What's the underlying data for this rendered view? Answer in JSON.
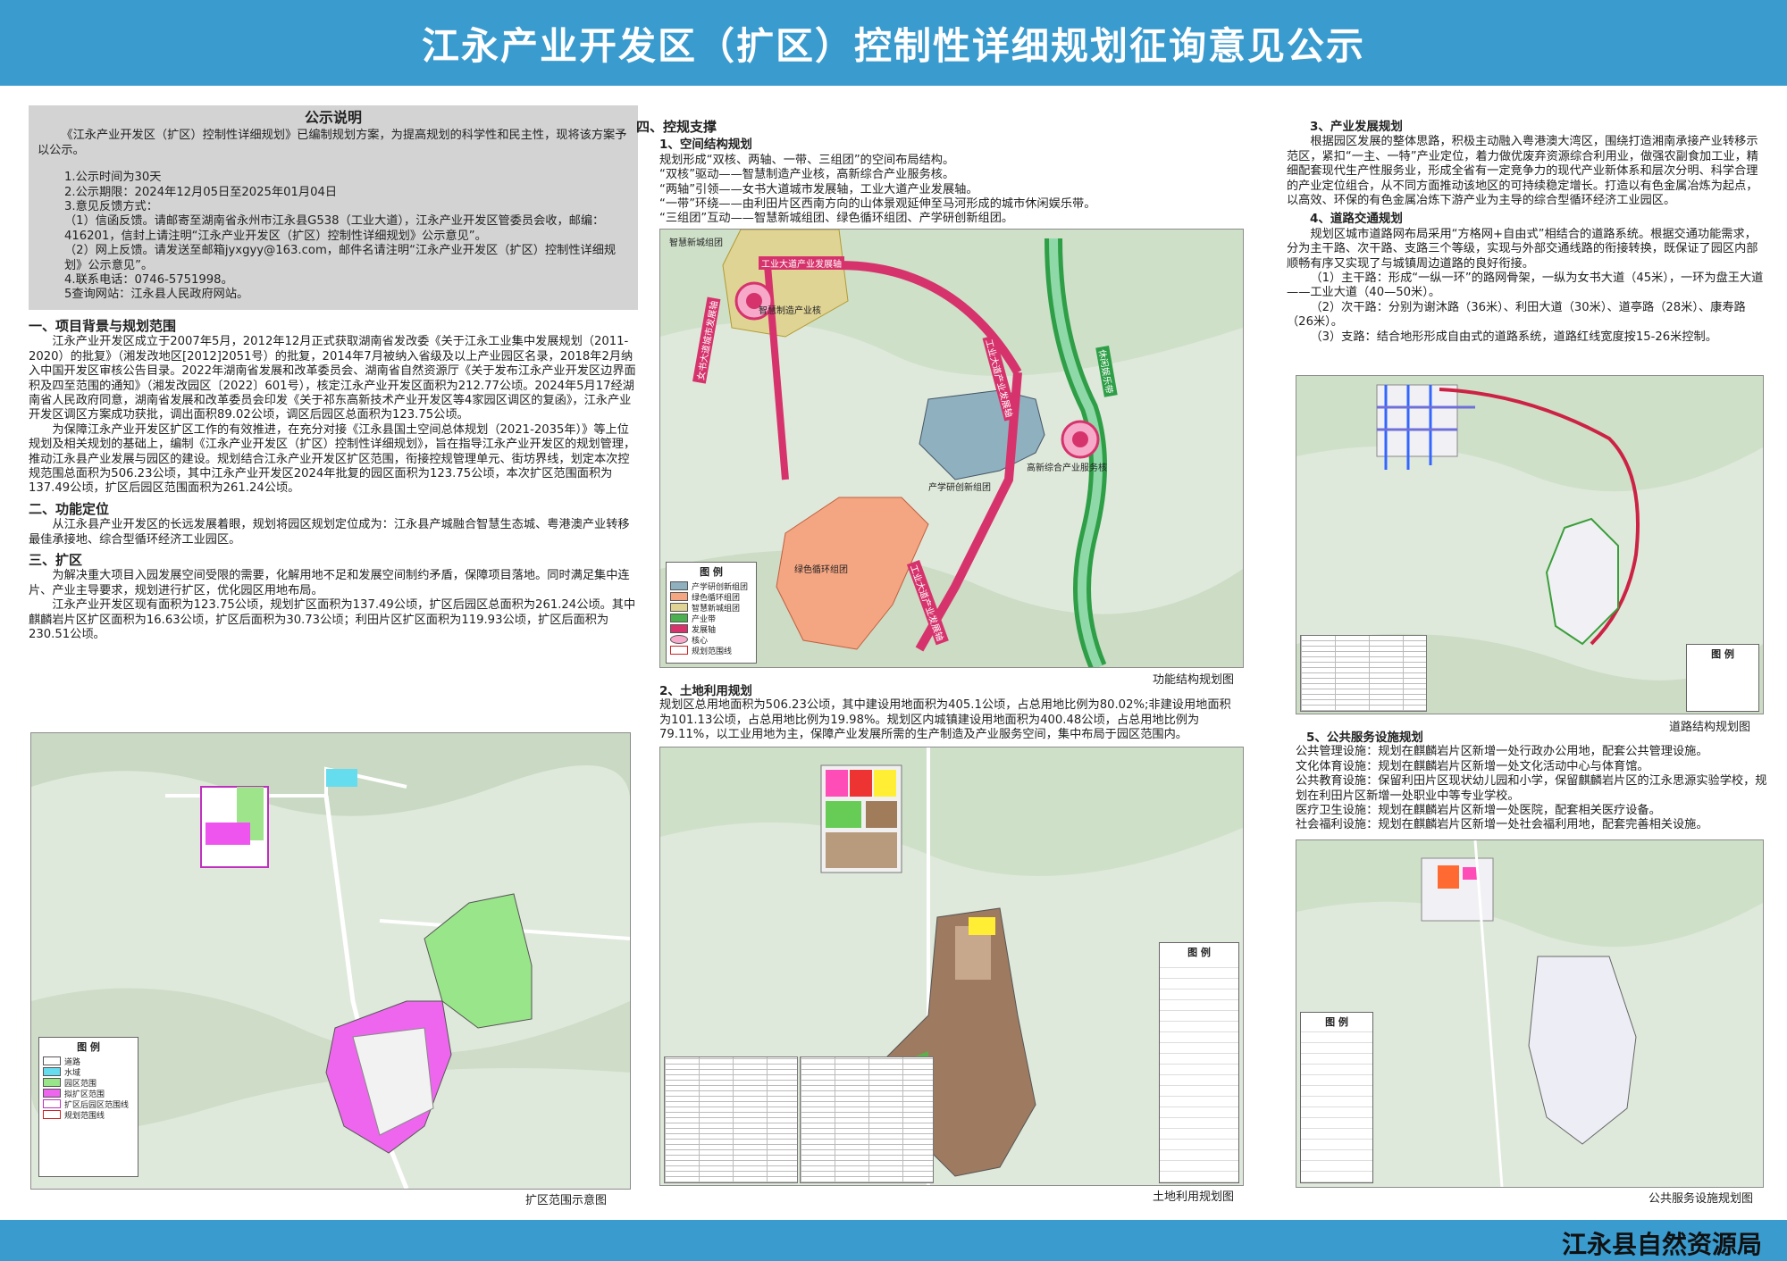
{
  "header": {
    "title": "江永产业开发区（扩区）控制性详细规划征询意见公示"
  },
  "footer": {
    "org": "江永县自然资源局"
  },
  "notice": {
    "title": "公示说明",
    "intro": "《江永产业开发区（扩区）控制性详细规划》已编制规划方案，为提高规划的科学性和民主性，现将该方案予以公示。",
    "items": [
      "1.公示时间为30天",
      "2.公示期限：2024年12月05日至2025年01月04日",
      "3.意见反馈方式：",
      "（1）信函反馈。请邮寄至湖南省永州市江永县G538（工业大道），江永产业开发区管委员会收，邮编：416201，信封上请注明“江永产业开发区（扩区）控制性详细规划》公示意见”。",
      "（2）网上反馈。请发送至邮箱jyxgyy@163.com，邮件名请注明“江永产业开发区（扩区）控制性详细规划》公示意见”。",
      "4.联系电话：0746-5751998。",
      "5查询网站：江永县人民政府网站。"
    ]
  },
  "sec1": {
    "title": "一、项目背景与规划范围",
    "p1": "江永产业开发区成立于2007年5月，2012年12月正式获取湖南省发改委《关于江永工业集中发展规划（2011-2020）的批复》（湘发改地区[2012]2051号）的批复，2014年7月被纳入省级及以上产业园区名录，2018年2月纳入中国开发区审核公告目录。2022年湖南省发展和改革委员会、湖南省自然资源厅《关于发布江永产业开发区边界面积及四至范围的通知》（湘发改园区〔2022〕601号），核定江永产业开发区面积为212.77公顷。2024年5月17经湖南省人民政府同意，湖南省发展和改革委员会印发《关于祁东高新技术产业开发区等4家园区调区的复函》，江永产业开发区调区方案成功获批，调出面积89.02公顷，调区后园区总面积为123.75公顷。",
    "p2": "为保障江永产业开发区扩区工作的有效推进，在充分对接《江永县国土空间总体规划（2021-2035年）》等上位规划及相关规划的基础上，编制《江永产业开发区（扩区）控制性详细规划》，旨在指导江永产业开发区的规划管理，推动江永县产业发展与园区的建设。规划结合江永产业开发区扩区范围，衔接控规管理单元、街坊界线，划定本次控规范围总面积为506.23公顷，其中江永产业开发区2024年批复的园区面积为123.75公顷，本次扩区范围面积为137.49公顷，扩区后园区范围面积为261.24公顷。"
  },
  "sec2": {
    "title": "二、功能定位",
    "p1": "从江永县产业开发区的长远发展着眼，规划将园区规划定位成为：江永县产城融合智慧生态城、粤港澳产业转移最佳承接地、综合型循环经济工业园区。"
  },
  "sec3": {
    "title": "三、扩区",
    "p1": "为解决重大项目入园发展空间受限的需要，化解用地不足和发展空间制约矛盾，保障项目落地。同时满足集中连片、产业主导要求，规划进行扩区，优化园区用地布局。",
    "p2": "江永产业开发区现有面积为123.75公顷，规划扩区面积为137.49公顷，扩区后园区总面积为261.24公顷。其中麒麟岩片区扩区面积为16.63公顷，扩区后面积为30.73公顷；利田片区扩区面积为119.93公顷，扩区后面积为230.51公顷。"
  },
  "sec4": {
    "title": "四、控规支撑",
    "s1": {
      "title": "1、空间结构规划",
      "lines": [
        "规划形成“双核、两轴、一带、三组团”的空间布局结构。",
        "“双核”驱动——智慧制造产业核，高新综合产业服务核。",
        "“两轴”引领——女书大道城市发展轴，工业大道产业发展轴。",
        "“一带”环绕——由利田片区西南方向的山体景观延伸至马河形成的城市休闲娱乐带。",
        "“三组团”互动——智慧新城组团、绿色循环组团、产学研创新组团。"
      ]
    },
    "s2": {
      "title": "2、土地利用规划",
      "p1": "规划区总用地面积为506.23公顷，其中建设用地面积为405.1公顷，占总用地比例为80.02%;非建设用地面积为101.13公顷，占总用地比例为19.98%。规划区内城镇建设用地面积为400.48公顷，占总用地比例为79.11%，以工业用地为主，保障产业发展所需的生产制造及产业服务空间，集中布局于园区范围内。"
    },
    "s3": {
      "title": "3、产业发展规划",
      "p1": "根据园区发展的整体思路，积极主动融入粤港澳大湾区，围绕打造湘南承接产业转移示范区，紧扣“一主、一特”产业定位，着力做优废弃资源综合利用业，做强农副食加工业，精细配套现代生产性服务业，形成全省有一定竞争力的现代产业新体系和层次分明、科学合理的产业定位组合，从不同方面推动该地区的可持续稳定增长。打造以有色金属冶炼为起点，以高效、环保的有色金属冶炼下游产业为主导的综合型循环经济工业园区。"
    },
    "s4": {
      "title": "4、道路交通规划",
      "p1": "规划区城市道路网布局采用“方格网+自由式”相结合的道路系统。根据交通功能需求，分为主干路、次干路、支路三个等级，实现与外部交通线路的衔接转换，既保证了园区内部顺畅有序又实现了与城镇周边道路的良好衔接。",
      "p2": "（1）主干路：形成“一纵一环”的路网骨架，一纵为女书大道（45米），一环为盘王大道——工业大道（40—50米）。",
      "p3": "（2）次干路：分别为谢沐路（36米）、利田大道（30米）、道亭路（28米）、康寿路（26米）。",
      "p4": "（3）支路：结合地形形成自由式的道路系统，道路红线宽度按15-26米控制。"
    },
    "s5": {
      "title": "5、公共服务设施规划",
      "lines": [
        "公共管理设施：规划在麒麟岩片区新增一处行政办公用地，配套公共管理设施。",
        "文化体育设施：规划在麒麟岩片区新增一处文化活动中心与体育馆。",
        "公共教育设施：保留利田片区现状幼儿园和小学，保留麒麟岩片区的江永思源实验学校，规划在利田片区新增一处职业中等专业学校。",
        "医疗卫生设施：规划在麒麟岩片区新增一处医院，配套相关医疗设备。",
        "社会福利设施：规划在麒麟岩片区新增一处社会福利用地，配套完善相关设施。"
      ]
    }
  },
  "maps": {
    "kuoqu": {
      "caption": "扩区范围示意图",
      "legend_title": "图 例",
      "legend": [
        "道路",
        "水域",
        "园区范围",
        "拟扩区范围",
        "扩区后园区范围线",
        "规划范围线"
      ]
    },
    "gongneng": {
      "caption": "功能结构规划图",
      "legend_title": "图 例",
      "legend": [
        "产学研创新组团",
        "绿色循环组团",
        "智慧新城组团",
        "产业带",
        "发展轴",
        "核心",
        "规划范围线"
      ],
      "labels": {
        "zhihui_xincheng": "智慧新城组团",
        "zhihui_zhizao": "智慧制造产业核",
        "nvshu_axis": "女书大道城市发展轴",
        "gongye_axis_top": "工业大道产业发展轴",
        "gongye_axis_right": "工业大道产业发展轴",
        "gaoxin": "高新综合产业服务核",
        "chanxueyan": "产学研创新组团",
        "lvse": "绿色循环组团",
        "gongye_axis_bottom": "工业大道产业发展轴",
        "xiuxian": "休闲娱乐带"
      }
    },
    "tudi": {
      "caption": "土地利用规划图",
      "legend_title": "图 例"
    },
    "daolu": {
      "caption": "道路结构规划图",
      "legend_title": "图 例"
    },
    "gonggong": {
      "caption": "公共服务设施规划图",
      "legend_title": "图 例"
    }
  },
  "colors": {
    "header": "#3a9bcf",
    "notice_bg": "#d3d3d3",
    "axis": "#d6336c",
    "green_belt": "#4caf50",
    "lvse_zone": "#f4a582",
    "gaoxin_zone": "#7fa6b8",
    "zhihui_zone": "#d8c878"
  }
}
